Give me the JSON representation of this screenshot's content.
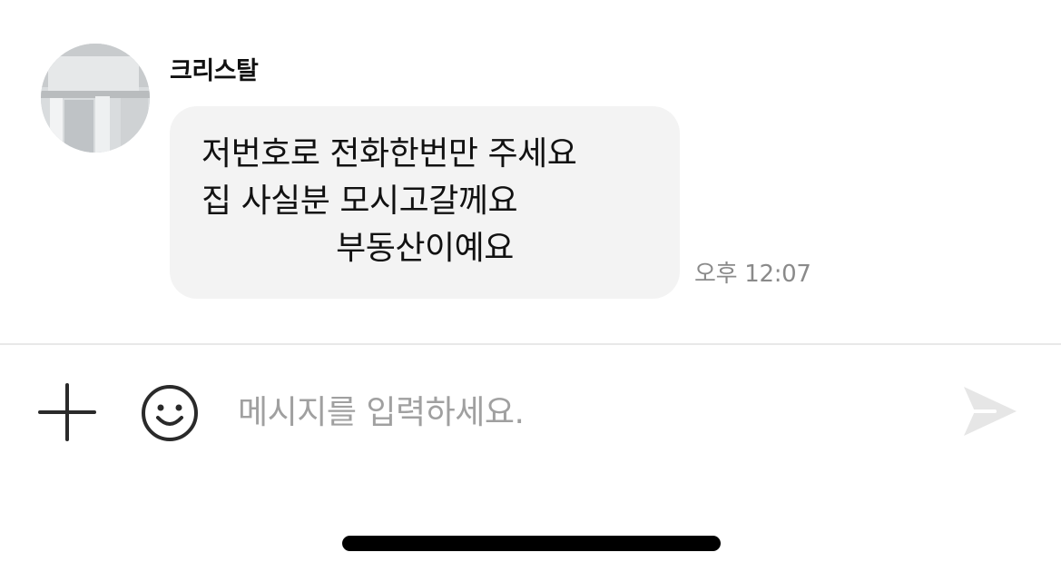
{
  "message": {
    "sender_name": "크리스탈",
    "lines": [
      "저번호로 전화한번만 주세요",
      "집 사실분 모시고갈께요",
      "부동산이예요"
    ],
    "timestamp": "오후 12:07"
  },
  "composer": {
    "placeholder": "메시지를 입력하세요.",
    "value": ""
  },
  "icons": {
    "attach": "plus-icon",
    "emoji": "smiley-icon",
    "send": "send-icon"
  },
  "colors": {
    "bubble_bg": "#f3f3f3",
    "timestamp": "#8a8a8a",
    "placeholder": "#a0a0a0",
    "send_disabled": "#e6e6e6"
  }
}
